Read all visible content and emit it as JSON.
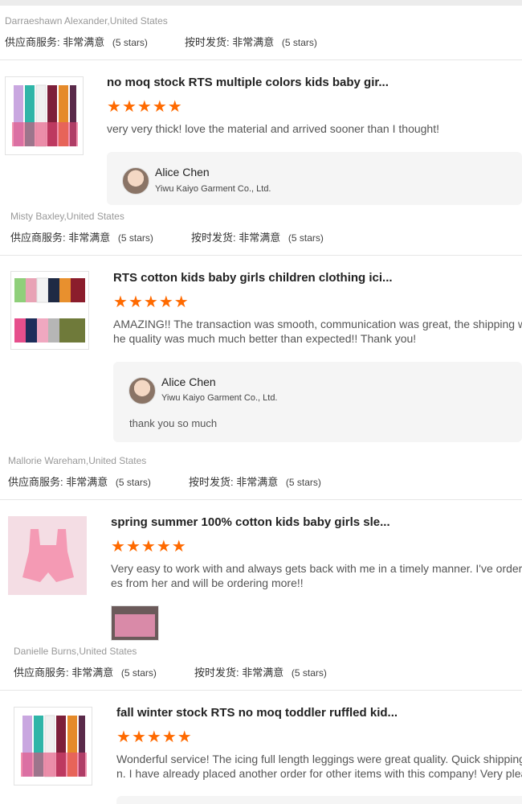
{
  "labels": {
    "supplier_service": "供应商服务:",
    "on_time": "按时发货:",
    "very_satisfied": "非常满意",
    "five_stars": "(5 stars)"
  },
  "reviews": [
    {
      "reviewer": "Darraeshawn Alexander,United States"
    },
    {
      "reviewer": "Misty Baxley,United States",
      "product_title": "no moq stock RTS multiple colors kids baby gir...",
      "rating": 5,
      "text_lines": [
        "very very thick! love the material and arrived sooner than I thought!"
      ],
      "reply": {
        "seller": "Alice Chen",
        "company": "Yiwu Kaiyo Garment Co., Ltd."
      }
    },
    {
      "reviewer": "Mallorie Wareham,United States",
      "product_title": "RTS cotton kids baby girls children clothing ici...",
      "rating": 5,
      "text_lines": [
        "AMAZING!! The transaction was smooth, communication was great, the shipping wa",
        "he quality was much much better than expected!! Thank you!"
      ],
      "reply": {
        "seller": "Alice Chen",
        "company": "Yiwu Kaiyo Garment Co., Ltd.",
        "text": "thank you so much"
      }
    },
    {
      "reviewer": "Danielle Burns,United States",
      "product_title": "spring summer 100% cotton kids baby girls sle...",
      "rating": 5,
      "text_lines": [
        "Very easy to work with and always gets back with me in a timely manner. I've ordered",
        "es from her and will be ordering more!!"
      ]
    },
    {
      "product_title": "fall winter stock RTS no moq toddler ruffled kid...",
      "rating": 5,
      "text_lines": [
        "Wonderful service! The icing full length leggings were great quality. Quick shipping a",
        "n. I have already placed another order for other items with this company! Very pleas"
      ]
    }
  ],
  "colors": {
    "star": "#ff6a00",
    "text": "#333333",
    "muted": "#999999",
    "reply_bg": "#f5f5f5"
  }
}
